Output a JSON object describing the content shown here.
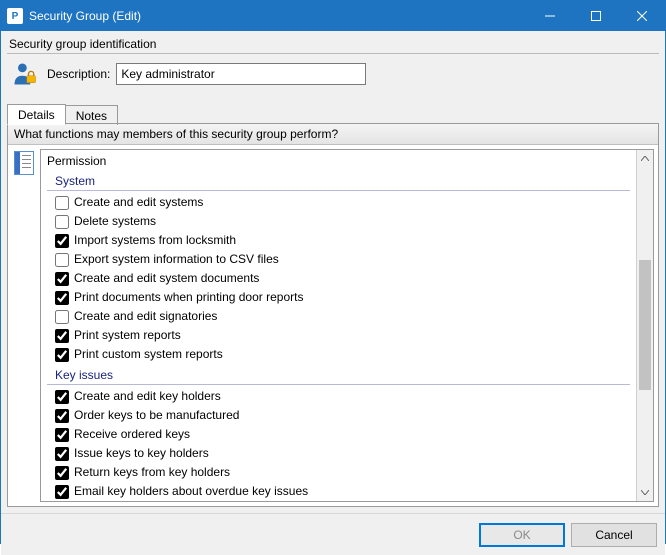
{
  "window": {
    "title": "Security Group (Edit)"
  },
  "identification": {
    "group_label": "Security group identification",
    "description_label": "Description:",
    "description_value": "Key administrator"
  },
  "tabs": {
    "details": "Details",
    "notes": "Notes"
  },
  "details": {
    "prompt": "What functions may members of this security group perform?",
    "permission_header": "Permission",
    "sections": [
      {
        "title": "System",
        "items": [
          {
            "label": "Create and edit systems",
            "checked": false
          },
          {
            "label": "Delete systems",
            "checked": false
          },
          {
            "label": "Import systems from locksmith",
            "checked": true
          },
          {
            "label": "Export system information to CSV files",
            "checked": false
          },
          {
            "label": "Create and edit system documents",
            "checked": true
          },
          {
            "label": "Print documents when printing door reports",
            "checked": true
          },
          {
            "label": "Create and edit signatories",
            "checked": false
          },
          {
            "label": "Print system reports",
            "checked": true
          },
          {
            "label": "Print custom system reports",
            "checked": true
          }
        ]
      },
      {
        "title": "Key issues",
        "items": [
          {
            "label": "Create and edit key holders",
            "checked": true
          },
          {
            "label": "Order keys to be manufactured",
            "checked": true
          },
          {
            "label": "Receive ordered keys",
            "checked": true
          },
          {
            "label": "Issue keys to key holders",
            "checked": true
          },
          {
            "label": "Return keys from key holders",
            "checked": true
          },
          {
            "label": "Email key holders about overdue key issues",
            "checked": true
          }
        ]
      }
    ]
  },
  "buttons": {
    "ok": "OK",
    "cancel": "Cancel"
  }
}
